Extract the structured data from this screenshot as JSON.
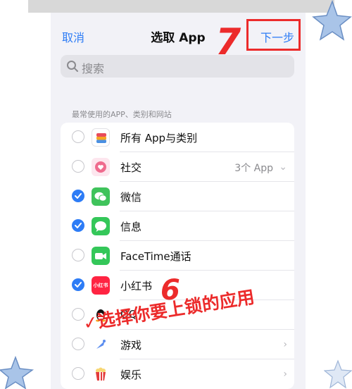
{
  "nav": {
    "cancel": "取消",
    "title": "选取 App",
    "next": "下一步"
  },
  "search": {
    "placeholder": "搜索",
    "icon": "search-icon"
  },
  "section_header": "最常使用的APP、类别和网站",
  "items": [
    {
      "label": "所有 App与类别",
      "checked": false,
      "icon": "stack-icon"
    },
    {
      "label": "社交",
      "detail": "3个 App",
      "checked": false,
      "icon": "social-icon",
      "chevron": "chevron-down-icon"
    },
    {
      "label": "微信",
      "checked": true,
      "icon": "wechat-icon"
    },
    {
      "label": "信息",
      "checked": true,
      "icon": "messages-icon"
    },
    {
      "label": "FaceTime通话",
      "checked": false,
      "icon": "facetime-icon"
    },
    {
      "label": "小红书",
      "checked": true,
      "icon": "xiaohongshu-icon",
      "icon_text": "小红书"
    },
    {
      "label": "QQ",
      "checked": false,
      "icon": "qq-icon"
    },
    {
      "label": "游戏",
      "checked": false,
      "icon": "games-icon",
      "chevron": "chevron-right-icon"
    },
    {
      "label": "娱乐",
      "checked": false,
      "icon": "popcorn-icon",
      "chevron": "chevron-right-icon"
    }
  ],
  "annotations": {
    "step7": "7",
    "step6": "6",
    "instruction": "✓选择你要上锁的应用"
  },
  "colors": {
    "accent": "#2d7cf6",
    "annotation": "#ec2b2b"
  }
}
